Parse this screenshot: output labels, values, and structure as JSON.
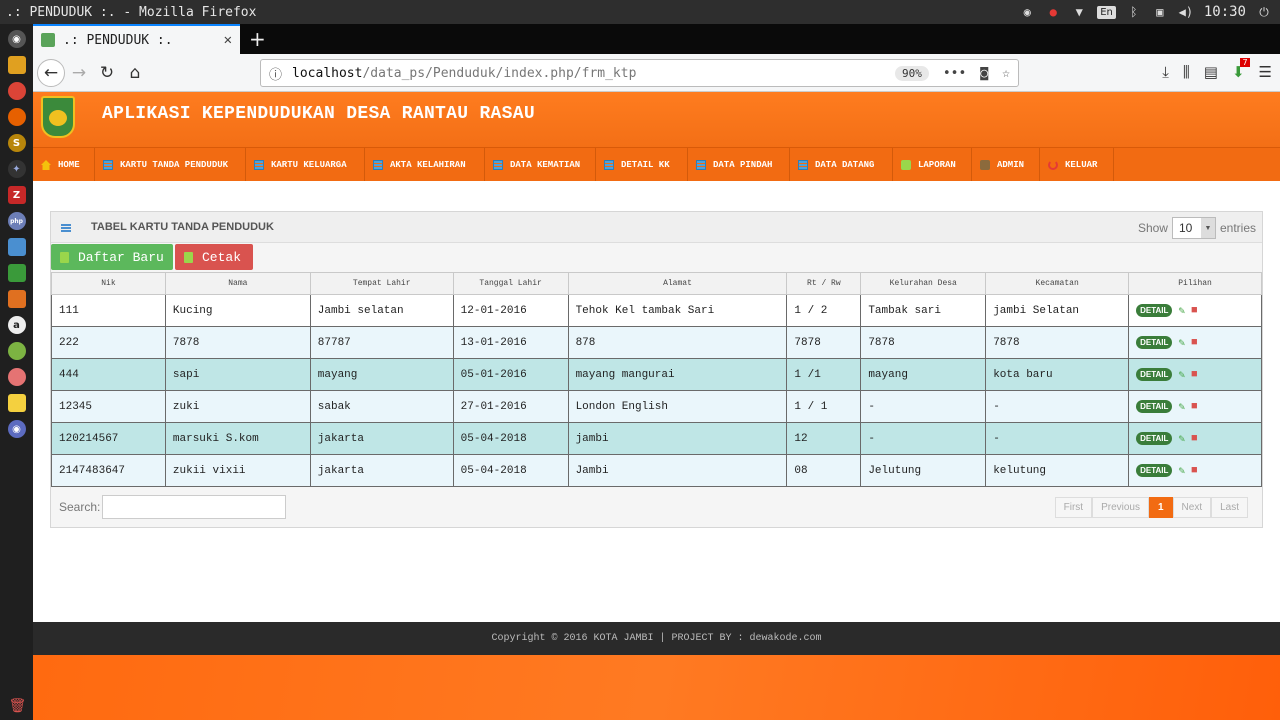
{
  "os": {
    "window_title": ".: PENDUDUK :. - Mozilla Firefox",
    "lang": "En",
    "clock": "10:30"
  },
  "browser": {
    "tab_title": ".: PENDUDUK :.",
    "url_host": "localhost",
    "url_path": "/data_ps/Penduduk/index.php/frm_ktp",
    "zoom": "90%",
    "url_more": "•••"
  },
  "app": {
    "title": "APLIKASI KEPENDUDUKAN DESA RANTAU RASAU",
    "menu": [
      {
        "label": "HOME",
        "icon": "home-icon"
      },
      {
        "label": "KARTU TANDA PENDUDUK",
        "icon": "list-icon"
      },
      {
        "label": "KARTU KELUARGA",
        "icon": "list-icon"
      },
      {
        "label": "AKTA KELAHIRAN",
        "icon": "list-icon"
      },
      {
        "label": "DATA KEMATIAN",
        "icon": "list-icon"
      },
      {
        "label": "DETAIL KK",
        "icon": "list-icon"
      },
      {
        "label": "DATA PINDAH",
        "icon": "list-icon"
      },
      {
        "label": "DATA DATANG",
        "icon": "list-icon"
      },
      {
        "label": "LAPORAN",
        "icon": "printer-icon"
      },
      {
        "label": "ADMIN",
        "icon": "admin-icon"
      },
      {
        "label": "KELUAR",
        "icon": "logout-icon"
      }
    ]
  },
  "panel": {
    "title": "TABEL KARTU TANDA PENDUDUK",
    "show_label": "Show",
    "show_value": "10",
    "entries_label": "entries",
    "btn_new": "Daftar Baru",
    "btn_print": "Cetak",
    "columns": [
      "Nik",
      "Nama",
      "Tempat Lahir",
      "Tanggal Lahir",
      "Alamat",
      "Rt / Rw",
      "Kelurahan Desa",
      "Kecamatan",
      "Pilihan"
    ],
    "rows": [
      [
        "111",
        "Kucing",
        "Jambi selatan",
        "12-01-2016",
        "Tehok Kel tambak Sari",
        "1 / 2",
        "Tambak sari",
        "jambi Selatan"
      ],
      [
        "222",
        "7878",
        "87787",
        "13-01-2016",
        "878",
        "7878",
        "7878",
        "7878"
      ],
      [
        "444",
        "sapi",
        "mayang",
        "05-01-2016",
        "mayang mangurai",
        "1 /1",
        "mayang",
        "kota baru"
      ],
      [
        "12345",
        "zuki",
        "sabak",
        "27-01-2016",
        "London English",
        "1 / 1",
        "-",
        "-"
      ],
      [
        "120214567",
        "marsuki S.kom",
        "jakarta",
        "05-04-2018",
        "jambi",
        "12",
        "-",
        "-"
      ],
      [
        "2147483647",
        "zukii vixii",
        "jakarta",
        "05-04-2018",
        "Jambi",
        "08",
        "Jelutung",
        "kelutung"
      ]
    ],
    "detail_label": "DETAIL",
    "search_label": "Search:",
    "pager": [
      "First",
      "Previous",
      "1",
      "Next",
      "Last"
    ]
  },
  "footer": {
    "text": "Copyright © 2016 KOTA JAMBI | PROJECT BY : dewakode.com"
  },
  "colors": {
    "brand_orange": "#f26b12",
    "success_green": "#5cb85c",
    "danger_red": "#d9534f"
  }
}
